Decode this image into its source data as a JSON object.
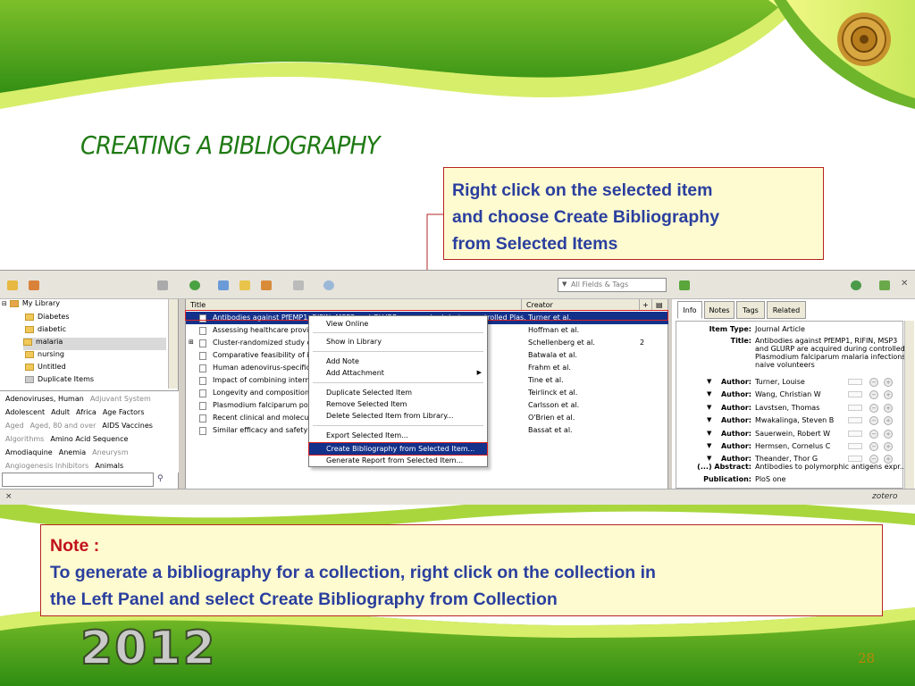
{
  "slide": {
    "title": "CREATING A BIBLIOGRAPHY",
    "callout_lines": [
      "Right click on the selected item",
      "and choose Create Bibliography",
      "from Selected Items"
    ],
    "note_label": "Note :",
    "note_lines": [
      "To generate a bibliography for a collection, right click on the collection in",
      "the Left Panel  and select Create Bibliography from Collection"
    ],
    "year": "2012",
    "page_number": "28",
    "colors": {
      "green": "#1f7a14",
      "callout_text": "#2a3f9e",
      "note_label": "#c0121b",
      "box_bg": "#fffbd0",
      "outline": "#b52424"
    }
  },
  "toolbar": {
    "search_placeholder": "All Fields & Tags",
    "icons": [
      "new-collection-icon",
      "new-group-icon",
      "actions-gear-icon",
      "new-item-icon",
      "add-by-identifier-icon",
      "new-note-icon",
      "attach-icon",
      "advanced-search-icon",
      "locate-icon",
      "sync-icon",
      "fullscreen-icon",
      "close-icon"
    ]
  },
  "collections": [
    {
      "label": "My Library",
      "type": "library"
    },
    {
      "label": "Diabetes"
    },
    {
      "label": "diabetic"
    },
    {
      "label": "malaria",
      "selected": true
    },
    {
      "label": "nursing"
    },
    {
      "label": "Untitled"
    },
    {
      "label": "Duplicate Items"
    }
  ],
  "tags": [
    [
      {
        "t": "Adenoviruses, Human"
      },
      {
        "t": "Adjuvant System",
        "muted": true
      }
    ],
    [
      {
        "t": "Adolescent"
      },
      {
        "t": "Adult"
      },
      {
        "t": "Africa"
      },
      {
        "t": "Age Factors"
      }
    ],
    [
      {
        "t": "Aged",
        "muted": true
      },
      {
        "t": "Aged, 80 and over",
        "muted": true
      },
      {
        "t": "AIDS Vaccines"
      }
    ],
    [
      {
        "t": "Algorithms",
        "muted": true
      },
      {
        "t": "Amino Acid Sequence"
      }
    ],
    [
      {
        "t": "Amodiaquine"
      },
      {
        "t": "Anemia"
      },
      {
        "t": "Aneurysm",
        "muted": true
      }
    ],
    [
      {
        "t": "Angiogenesis Inhibitors",
        "muted": true
      },
      {
        "t": "Animals"
      }
    ]
  ],
  "columns": {
    "title": "Title",
    "creator": "Creator"
  },
  "items": [
    {
      "title": "Antibodies against PfEMP1, RIFIN, MSP3 and GLURP are acquired during controlled Plas...",
      "creator": "Turner et al.",
      "extra": "",
      "selected": true
    },
    {
      "title": "Assessing healthcare provide... treated n...",
      "creator": "Hoffman et al.",
      "extra": ""
    },
    {
      "title": "Cluster-randomized study of ... nts (IPT...",
      "creator": "Schellenberg et al.",
      "extra": "2"
    },
    {
      "title": "Comparative feasibility of imp... parasitol...",
      "creator": "Batwala et al.",
      "extra": ""
    },
    {
      "title": "Human adenovirus-specific T... 35-vecto...",
      "creator": "Frahm et al.",
      "extra": ""
    },
    {
      "title": "Impact of combining intermitt... of malari...",
      "creator": "Tine et al.",
      "extra": ""
    },
    {
      "title": "Longevity and composition o... asmodi...",
      "creator": "Teirlinck et al.",
      "extra": ""
    },
    {
      "title": "Plasmodium falciparum popul... al drug t...",
      "creator": "Carlsson et al.",
      "extra": ""
    },
    {
      "title": "Recent clinical and molecular... modium f...",
      "creator": "O'Brien et al.",
      "extra": ""
    },
    {
      "title": "Similar efficacy and safety o... ants an...",
      "creator": "Bassat et al.",
      "extra": ""
    }
  ],
  "context_menu": {
    "items": [
      {
        "label": "View Online",
        "group": 0
      },
      {
        "label": "Show in Library",
        "group": 1
      },
      {
        "label": "Add Note",
        "group": 2
      },
      {
        "label": "Add Attachment",
        "group": 2,
        "submenu": true
      },
      {
        "label": "Duplicate Selected Item",
        "group": 3
      },
      {
        "label": "Remove Selected Item",
        "group": 3
      },
      {
        "label": "Delete Selected Item from Library...",
        "group": 3
      },
      {
        "label": "Export Selected Item...",
        "group": 4
      },
      {
        "label": "Create Bibliography from Selected Item...",
        "group": 4,
        "highlighted": true
      },
      {
        "label": "Generate Report from Selected Item...",
        "group": 4
      }
    ]
  },
  "item_pane": {
    "tabs": [
      "Info",
      "Notes",
      "Tags",
      "Related"
    ],
    "active_tab": "Info",
    "item_type_label": "Item Type:",
    "item_type": "Journal Article",
    "title_label": "Title:",
    "title_lines": [
      "Antibodies against PfEMP1, RIFIN, MSP3",
      "and GLURP are acquired during controlled",
      "Plasmodium falciparum malaria infections in",
      "naive volunteers"
    ],
    "author_label": "Author:",
    "authors": [
      "Turner, Louise",
      "Wang, Christian W",
      "Lavstsen, Thomas",
      "Mwakalinga, Steven B",
      "Sauerwein, Robert W",
      "Hermsen, Cornelus C",
      "Theander, Thor G"
    ],
    "abstract_label": "(...) Abstract:",
    "abstract": "Antibodies to polymorphic antigens expr...",
    "publication_label": "Publication:",
    "publication": "PloS one"
  },
  "status": {
    "close": "×",
    "brand": "zotero"
  }
}
